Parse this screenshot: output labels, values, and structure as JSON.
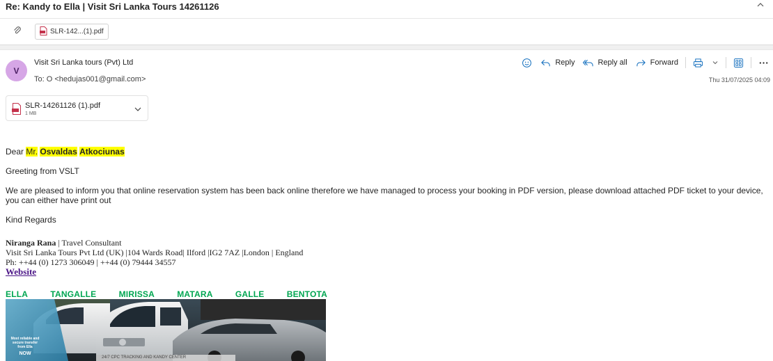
{
  "header": {
    "subject": "Re: Kandy to Ella | Visit Sri Lanka Tours 14261126",
    "attachment_pill": "SLR-142...(1).pdf"
  },
  "message": {
    "avatar_initial": "V",
    "sender": "Visit Sri Lanka tours (Pvt) Ltd",
    "to_label": "To:",
    "to_value": "O <hedujas001@gmail.com>",
    "date": "Thu 31/07/2025 04:09",
    "actions": {
      "reply": "Reply",
      "reply_all": "Reply all",
      "forward": "Forward"
    },
    "attachment": {
      "name": "SLR-14261126 (1).pdf",
      "size": "1 MB"
    }
  },
  "body": {
    "salutation": "Dear",
    "title": "Mr.",
    "first_name": "Osvaldas",
    "last_name": "Atkociunas",
    "greeting": "Greeting from VSLT",
    "paragraph": "We are pleased to inform you that online reservation system has been back online therefore we have managed to process your booking in PDF version, please download attached PDF ticket to your device, you can either have print out",
    "closing": "Kind Regards"
  },
  "signature": {
    "name": "Niranga Rana",
    "role": " | Travel Consultant",
    "company_line": "Visit Sri Lanka Tours Pvt Ltd (UK) |104 Wards Road| Ilford |IG2 7AZ |London | England",
    "phone_line": "Ph: ++44 (0) 1273 306049 | ++44 (0) 79444 34557",
    "website": "Website"
  },
  "banner": {
    "towns": [
      "ELLA",
      "TANGALLE",
      "MIRISSA",
      "MATARA",
      "GALLE",
      "BENTOTA"
    ],
    "promo_line1": "Most reliable and",
    "promo_line2": "secure transfer",
    "promo_line3": "from Ella",
    "promo_now": "NOW",
    "bottom_text": "24/7 CPC TRACKING AND KANDY CENTER"
  },
  "colors": {
    "accent": "#0f6cbd",
    "highlight": "#ffff00",
    "town_green": "#00a651",
    "link_purple": "#4a1486",
    "avatar_bg": "#d6a6e6"
  }
}
